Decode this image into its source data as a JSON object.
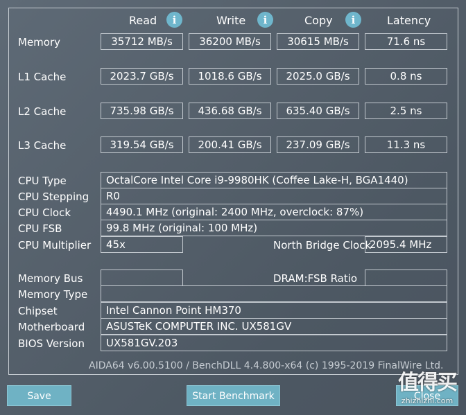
{
  "headers": {
    "read": "Read",
    "write": "Write",
    "copy": "Copy",
    "latency": "Latency"
  },
  "info_icon_glyph": "i",
  "rows": {
    "memory": {
      "label": "Memory",
      "read": "35712 MB/s",
      "write": "36200 MB/s",
      "copy": "30615 MB/s",
      "latency": "71.6 ns"
    },
    "l1": {
      "label": "L1 Cache",
      "read": "2023.7 GB/s",
      "write": "1018.6 GB/s",
      "copy": "2025.0 GB/s",
      "latency": "0.8 ns"
    },
    "l2": {
      "label": "L2 Cache",
      "read": "735.98 GB/s",
      "write": "436.68 GB/s",
      "copy": "635.40 GB/s",
      "latency": "2.5 ns"
    },
    "l3": {
      "label": "L3 Cache",
      "read": "319.54 GB/s",
      "write": "200.41 GB/s",
      "copy": "237.09 GB/s",
      "latency": "11.3 ns"
    }
  },
  "info": {
    "cpu_type": {
      "label": "CPU Type",
      "value": "OctalCore Intel Core i9-9980HK  (Coffee Lake-H, BGA1440)"
    },
    "cpu_stepping": {
      "label": "CPU Stepping",
      "value": "R0"
    },
    "cpu_clock": {
      "label": "CPU Clock",
      "value": "4490.1 MHz  (original: 2400 MHz, overclock: 87%)"
    },
    "cpu_fsb": {
      "label": "CPU FSB",
      "value": "99.8 MHz  (original: 100 MHz)"
    },
    "cpu_multiplier": {
      "label": "CPU Multiplier",
      "value": "45x"
    },
    "north_bridge_clock": {
      "label": "North Bridge Clock",
      "value": "2095.4 MHz"
    },
    "memory_bus": {
      "label": "Memory Bus",
      "value": ""
    },
    "dram_fsb_ratio": {
      "label": "DRAM:FSB Ratio",
      "value": ""
    },
    "memory_type": {
      "label": "Memory Type",
      "value": ""
    },
    "chipset": {
      "label": "Chipset",
      "value": "Intel Cannon Point HM370"
    },
    "motherboard": {
      "label": "Motherboard",
      "value": "ASUSTeK COMPUTER INC. UX581GV"
    },
    "bios_version": {
      "label": "BIOS Version",
      "value": "UX581GV.203"
    }
  },
  "footer": "AIDA64 v6.00.5100 / BenchDLL 4.4.800-x64  (c) 1995-2019 FinalWire Ltd.",
  "buttons": {
    "save": "Save",
    "start": "Start Benchmark",
    "close": "Close"
  },
  "watermark": {
    "chars": "值得买",
    "url": "zhizhizhi.com"
  },
  "colors": {
    "accent": "#6fb2c4",
    "info_icon": "#6fb6cc",
    "border": "#c4cad0"
  }
}
